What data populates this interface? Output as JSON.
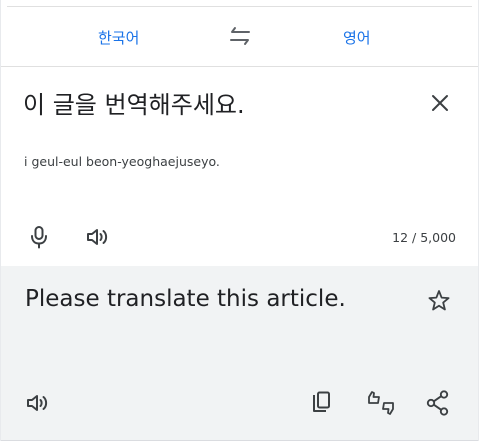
{
  "languages": {
    "source": "한국어",
    "target": "영어"
  },
  "source": {
    "text": "이 글을 번역해주세요.",
    "romanization": "i geul-eul beon-yeoghaejuseyo.",
    "char_count": "12 / 5,000"
  },
  "translation": {
    "text": "Please translate this article."
  },
  "icons": {
    "swap": "swap-arrows-icon",
    "clear": "close-icon",
    "microphone": "microphone-icon",
    "speaker_source": "speaker-icon",
    "favorite": "star-icon",
    "speaker_translation": "speaker-icon",
    "copy": "copy-icon",
    "feedback": "thumbs-up-down-icon",
    "share": "share-icon"
  },
  "colors": {
    "accent": "#1a73e8",
    "text_primary": "#202124",
    "text_secondary": "#3c4043",
    "icon": "#5f6368",
    "translation_background": "#f1f3f4"
  }
}
